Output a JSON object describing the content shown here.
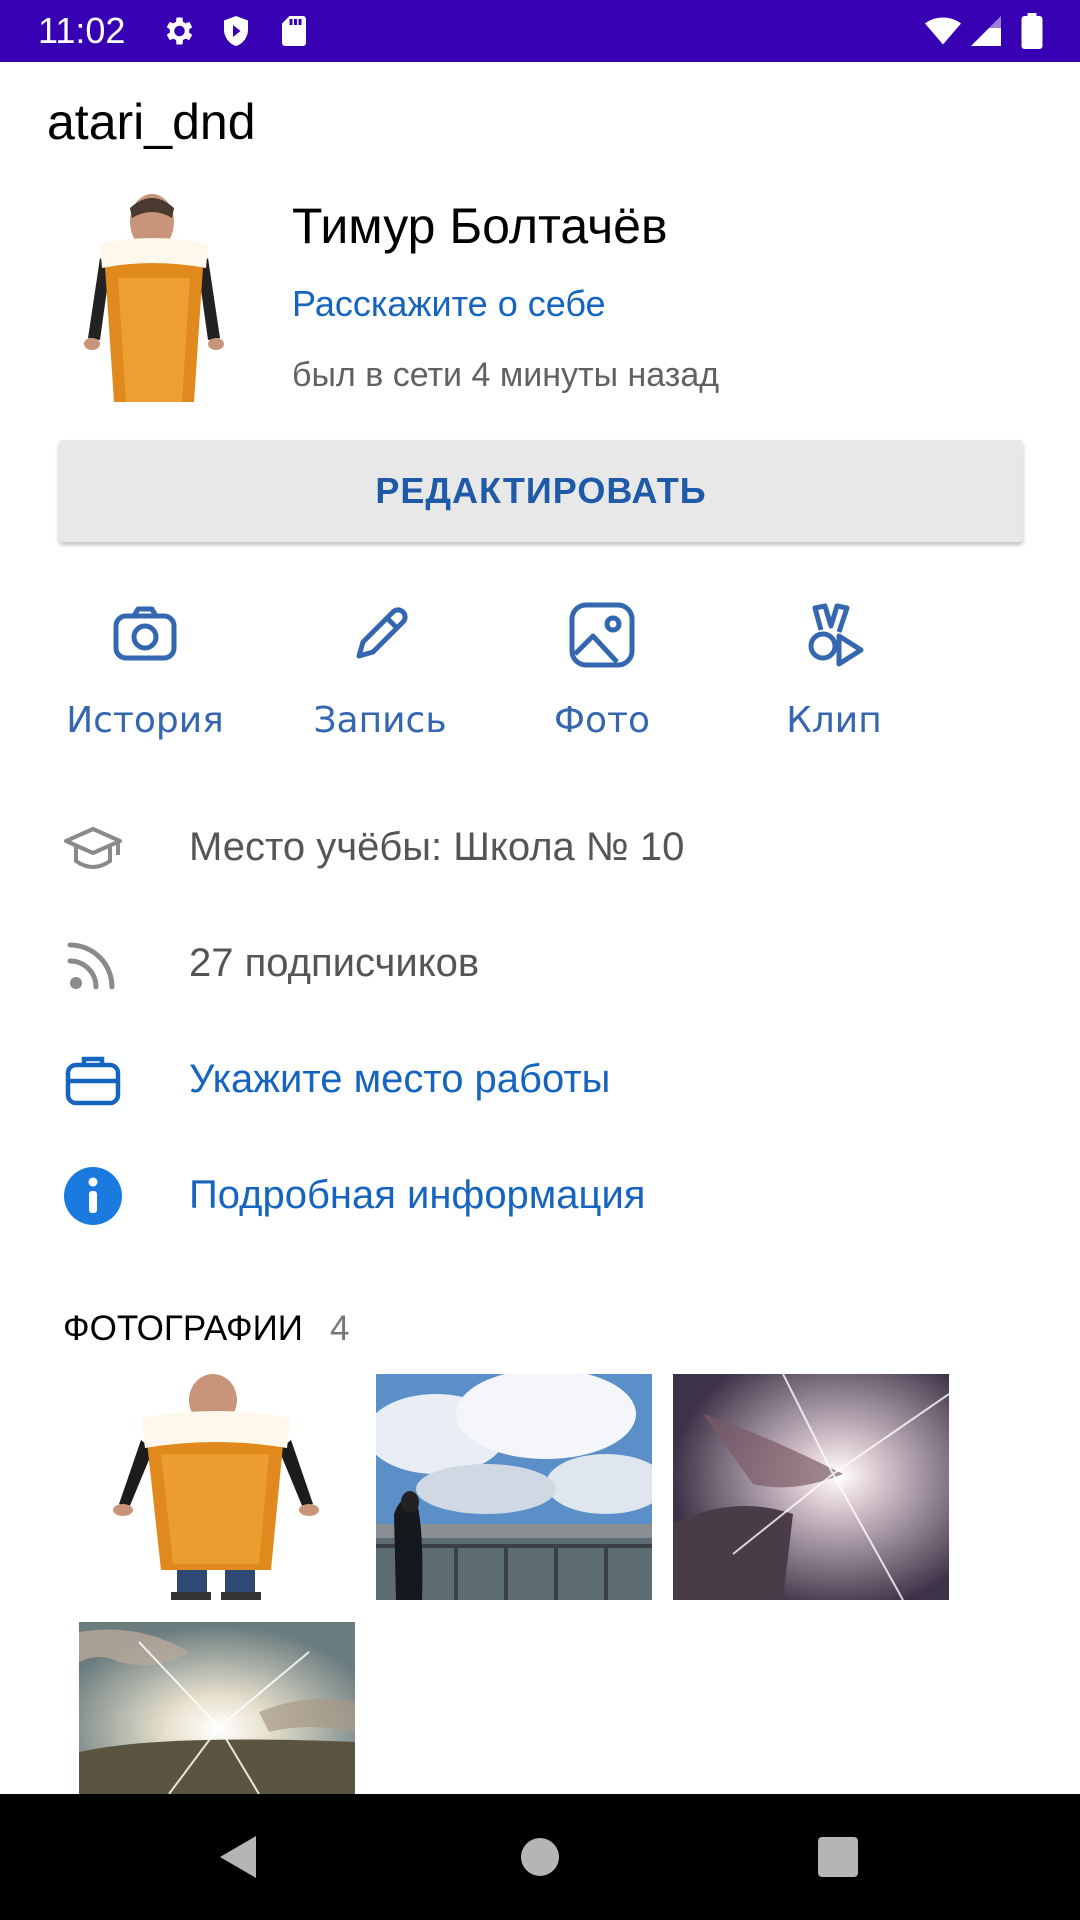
{
  "status_bar": {
    "time": "11:02",
    "background": "#3700b3",
    "left_icons": [
      "settings-icon",
      "shield-icon",
      "sd-card-icon"
    ],
    "right_icons": [
      "wifi-icon",
      "signal-icon",
      "battery-icon"
    ]
  },
  "header": {
    "username": "atari_dnd"
  },
  "profile": {
    "name": "Тимур Болтачёв",
    "about_link": "Расскажите о себе",
    "last_seen": "был в сети 4 минуты назад",
    "edit_button": "РЕДАКТИРОВАТЬ"
  },
  "actions": [
    {
      "label": "История",
      "icon": "camera-icon"
    },
    {
      "label": "Запись",
      "icon": "pencil-icon"
    },
    {
      "label": "Фото",
      "icon": "image-icon"
    },
    {
      "label": "Клип",
      "icon": "clip-icon"
    }
  ],
  "info": [
    {
      "text": "Место учёбы: Школа № 10",
      "icon": "education-icon",
      "link": false
    },
    {
      "text": "27 подписчиков",
      "icon": "rss-icon",
      "link": false
    },
    {
      "text": "Укажите место работы",
      "icon": "briefcase-icon",
      "link": true
    },
    {
      "text": "Подробная информация",
      "icon": "info-icon",
      "link": true
    }
  ],
  "photos": {
    "title": "ФОТОГРАФИИ",
    "count": "4"
  },
  "nav": [
    "back-icon",
    "home-icon",
    "recents-icon"
  ],
  "colors": {
    "accent": "#1565c0",
    "status_bar": "#3700b3",
    "action_label": "#3567b0"
  }
}
